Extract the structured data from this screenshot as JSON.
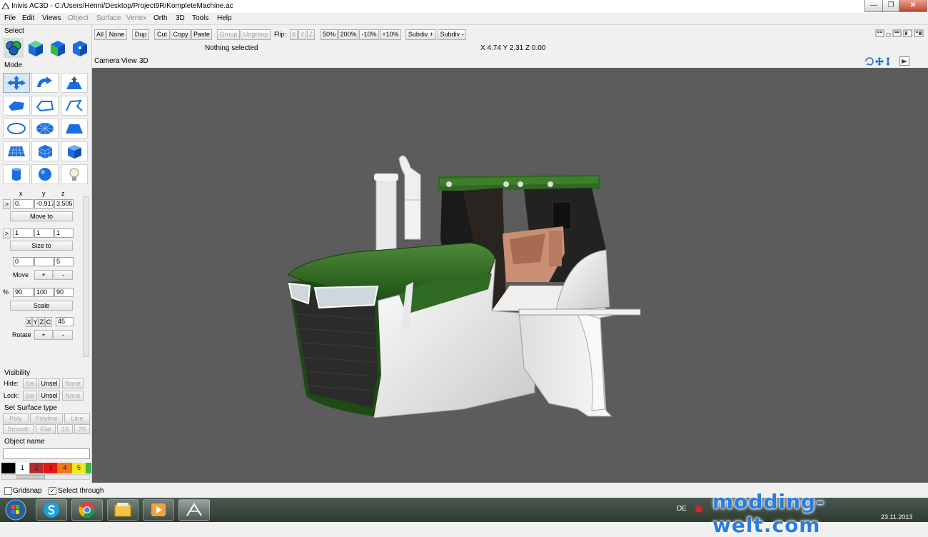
{
  "window": {
    "title": "Inivis AC3D - C:/Users/Henni/Desktop/Project9R/KompleteMachine.ac",
    "minimize": "—",
    "maximize": "❐",
    "close": "✕"
  },
  "menu": [
    "File",
    "Edit",
    "Views",
    "Object",
    "Surface",
    "Vertex",
    "Orth",
    "3D",
    "Tools",
    "Help"
  ],
  "toolbar": {
    "all": "All",
    "none": "None",
    "dup": "Dup",
    "cut": "Cut",
    "copy": "Copy",
    "paste": "Paste",
    "group": "Group",
    "ungroup": "Ungroup",
    "flip": "Flip:",
    "fx": "X",
    "fy": "Y",
    "fz": "Z",
    "z50": "50%",
    "z200": "200%",
    "zm10": "-10%",
    "zp10": "+10%",
    "subdiv_plus": "Subdiv +",
    "subdiv_minus": "Subdiv -"
  },
  "status": {
    "selection": "Nothing selected",
    "coords": "X 4.74 Y 2.31 Z 0.00"
  },
  "view": {
    "camera": "Camera",
    "view": "View",
    "mode": "3D"
  },
  "left": {
    "select": "Select",
    "mode": "Mode",
    "axes": {
      "x": "x",
      "y": "y",
      "z": "z"
    },
    "pos": {
      "arrow": ">",
      "x": "0.",
      "y": "-0.917",
      "z": "3.5058"
    },
    "move_to": "Move to",
    "size": {
      "arrow": ">",
      "x": "1",
      "y": "1",
      "z": "1"
    },
    "size_to": "Size to",
    "move_vals": {
      "x": "0",
      "y": "",
      "z": "5"
    },
    "move": "Move",
    "plus": "+",
    "minus": "-",
    "pct": "%",
    "scale_vals": {
      "x": "90",
      "y": "100",
      "z": "90"
    },
    "scale": "Scale",
    "rot_axes": {
      "x": "X",
      "y": "Y",
      "z": "Z",
      "c": "C"
    },
    "rot_val": "45",
    "rotate": "Rotate",
    "visibility": "Visibility",
    "hide": "Hide:",
    "lock": "Lock:",
    "sel": "Sel",
    "unsel": "Unsel",
    "none": "None",
    "surface_type": "Set Surface type",
    "poly": "Poly",
    "polyline": "Polyline",
    "line": "Line",
    "smooth": "Smooth",
    "flat": "Flat",
    "s1": "1S",
    "s2": "2S",
    "object_name": "Object name",
    "palette": [
      {
        "label": "",
        "color": "#000000"
      },
      {
        "label": "1",
        "color": "#ffffff"
      },
      {
        "label": "2",
        "color": "#b03030"
      },
      {
        "label": "3",
        "color": "#e01818"
      },
      {
        "label": "4",
        "color": "#f07818"
      },
      {
        "label": "5",
        "color": "#f0e818"
      },
      {
        "label": "",
        "color": "#30c030"
      }
    ]
  },
  "bottom": {
    "gridsnap": "Gridsnap",
    "select_through": "Select through",
    "check": "✓"
  },
  "taskbar": {
    "lang": "DE",
    "date": "23.11.2013",
    "time": ""
  },
  "watermark": "modding-welt.com"
}
